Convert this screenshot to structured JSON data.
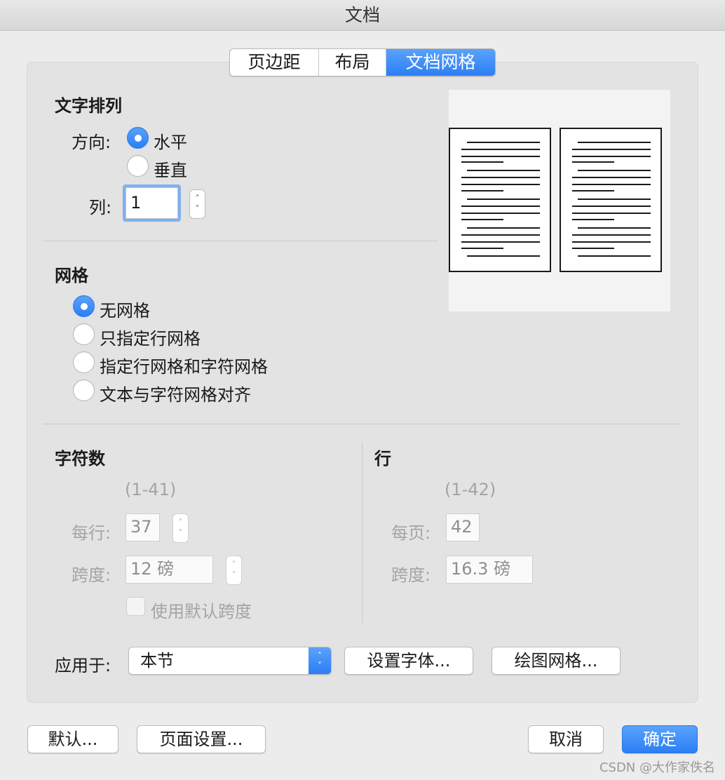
{
  "window": {
    "title": "文档"
  },
  "tabs": [
    {
      "label": "页边距",
      "active": false
    },
    {
      "label": "布局",
      "active": false
    },
    {
      "label": "文档网格",
      "active": true
    }
  ],
  "text_layout": {
    "heading": "文字排列",
    "direction_label": "方向:",
    "direction_options": [
      {
        "label": "水平",
        "checked": true
      },
      {
        "label": "垂直",
        "checked": false
      }
    ],
    "columns_label": "列:",
    "columns_value": "1"
  },
  "grid": {
    "heading": "网格",
    "options": [
      {
        "label": "无网格",
        "checked": true
      },
      {
        "label": "只指定行网格",
        "checked": false
      },
      {
        "label": "指定行网格和字符网格",
        "checked": false
      },
      {
        "label": "文本与字符网格对齐",
        "checked": false
      }
    ]
  },
  "characters": {
    "heading": "字符数",
    "range": "(1-41)",
    "per_line_label": "每行:",
    "per_line_value": "37",
    "pitch_label": "跨度:",
    "pitch_value": "12 磅",
    "default_pitch_label": "使用默认跨度"
  },
  "lines": {
    "heading": "行",
    "range": "(1-42)",
    "per_page_label": "每页:",
    "per_page_value": "42",
    "pitch_label": "跨度:",
    "pitch_value": "16.3 磅"
  },
  "apply": {
    "label": "应用于:",
    "value": "本节",
    "set_font_button": "设置字体...",
    "drawing_grid_button": "绘图网格..."
  },
  "footer": {
    "default_button": "默认...",
    "page_setup_button": "页面设置...",
    "cancel_button": "取消",
    "ok_button": "确定"
  },
  "watermark": "CSDN @大作家佚名",
  "colors": {
    "accent": "#2b7ef4",
    "disabled_text": "#a4a4a4"
  }
}
